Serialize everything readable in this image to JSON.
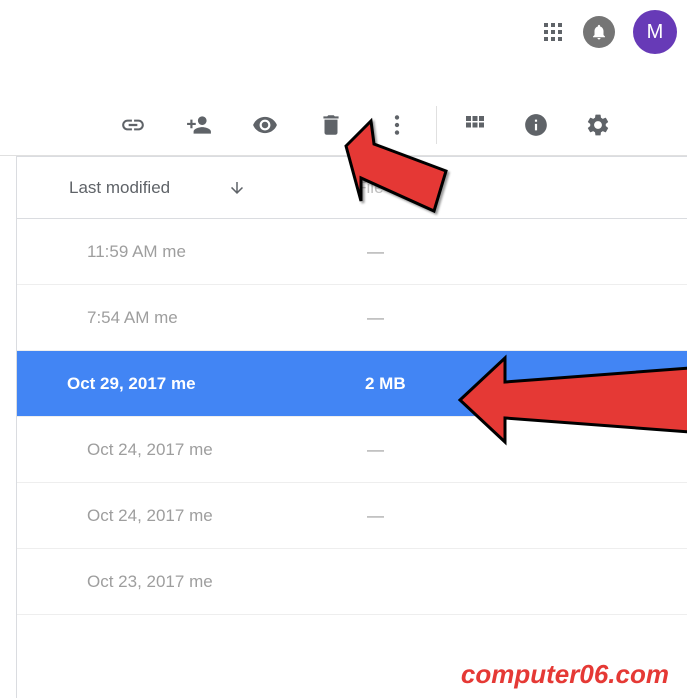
{
  "avatar": {
    "letter": "M"
  },
  "toolbar": {
    "link_icon": "get-link",
    "share_icon": "add-person",
    "preview_icon": "preview",
    "trash_icon": "remove",
    "more_icon": "more",
    "grid_icon": "grid-view",
    "details_icon": "details",
    "settings_icon": "settings"
  },
  "columns": {
    "modified": "Last modified",
    "size": "File size"
  },
  "rows": [
    {
      "time": "11:59 AM me",
      "size": "—",
      "selected": false
    },
    {
      "time": "7:54 AM me",
      "size": "—",
      "selected": false
    },
    {
      "time": "Oct 29, 2017 me",
      "size": "2 MB",
      "selected": true
    },
    {
      "time": "Oct 24, 2017 me",
      "size": "—",
      "selected": false
    },
    {
      "time": "Oct 24, 2017 me",
      "size": "—",
      "selected": false
    },
    {
      "time": "Oct 23, 2017 me",
      "size": "",
      "selected": false
    }
  ],
  "watermark": "computer06.com"
}
